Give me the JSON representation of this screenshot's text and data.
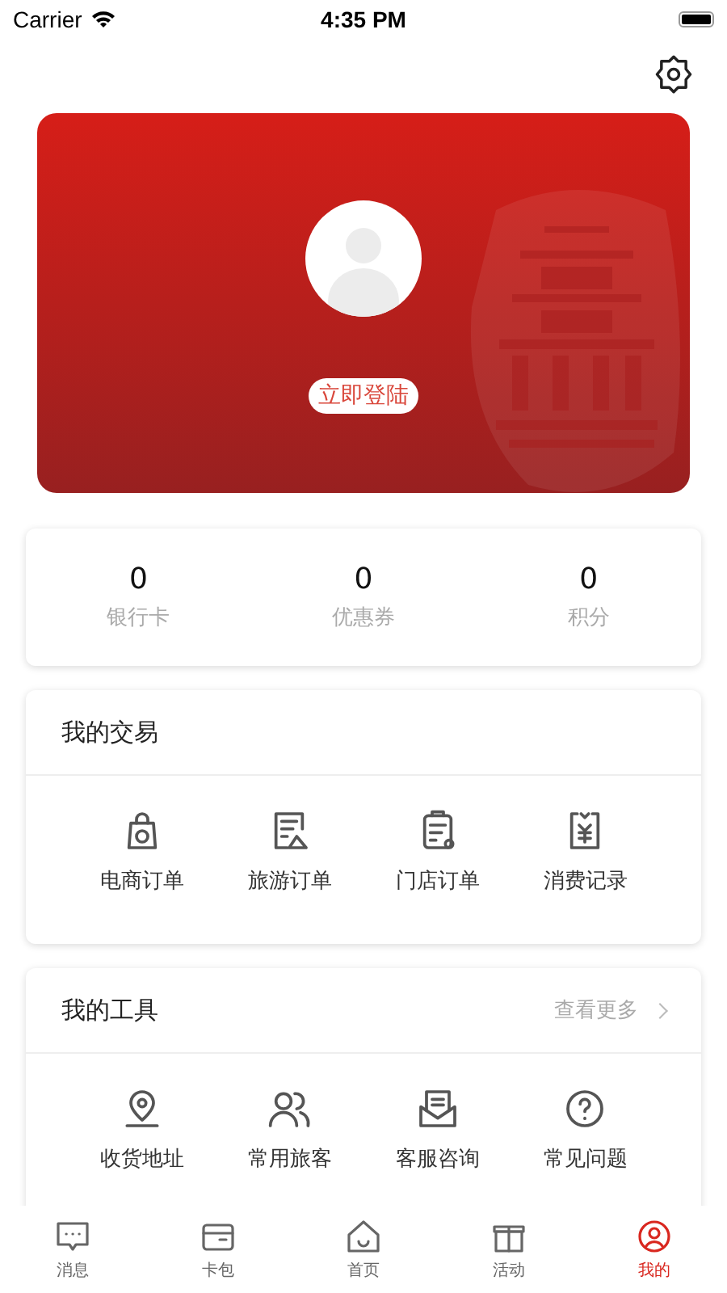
{
  "status_bar": {
    "carrier": "Carrier",
    "time": "4:35 PM"
  },
  "profile_card": {
    "login_button": "立即登陆"
  },
  "stats": [
    {
      "value": "0",
      "label": "银行卡"
    },
    {
      "value": "0",
      "label": "优惠券"
    },
    {
      "value": "0",
      "label": "积分"
    }
  ],
  "transactions": {
    "title": "我的交易",
    "items": [
      {
        "label": "电商订单"
      },
      {
        "label": "旅游订单"
      },
      {
        "label": "门店订单"
      },
      {
        "label": "消费记录"
      }
    ]
  },
  "tools": {
    "title": "我的工具",
    "more": "查看更多",
    "items": [
      {
        "label": "收货地址"
      },
      {
        "label": "常用旅客"
      },
      {
        "label": "客服咨询"
      },
      {
        "label": "常见问题"
      }
    ]
  },
  "tab_bar": [
    {
      "label": "消息",
      "selected": false
    },
    {
      "label": "卡包",
      "selected": false
    },
    {
      "label": "首页",
      "selected": false
    },
    {
      "label": "活动",
      "selected": false
    },
    {
      "label": "我的",
      "selected": true
    }
  ]
}
